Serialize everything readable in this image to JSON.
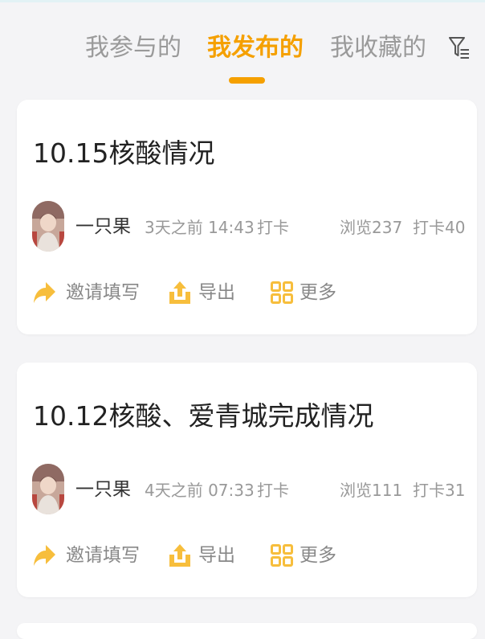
{
  "tabs": {
    "items": [
      {
        "label": "我参与的",
        "active": false
      },
      {
        "label": "我发布的",
        "active": true
      },
      {
        "label": "我收藏的",
        "active": false
      }
    ],
    "filter_icon": "filter-list-icon",
    "accent_color": "#f5a000"
  },
  "cards": [
    {
      "title": "10.15核酸情况",
      "author": "一只果",
      "time": "3天之前 14:43",
      "type": "打卡",
      "views": "浏览237",
      "checkins": "打卡40",
      "actions": {
        "invite": "邀请填写",
        "export": "导出",
        "more": "更多"
      }
    },
    {
      "title": "10.12核酸、爱青城完成情况",
      "author": "一只果",
      "time": "4天之前 07:33",
      "type": "打卡",
      "views": "浏览111",
      "checkins": "打卡31",
      "actions": {
        "invite": "邀请填写",
        "export": "导出",
        "more": "更多"
      }
    }
  ]
}
